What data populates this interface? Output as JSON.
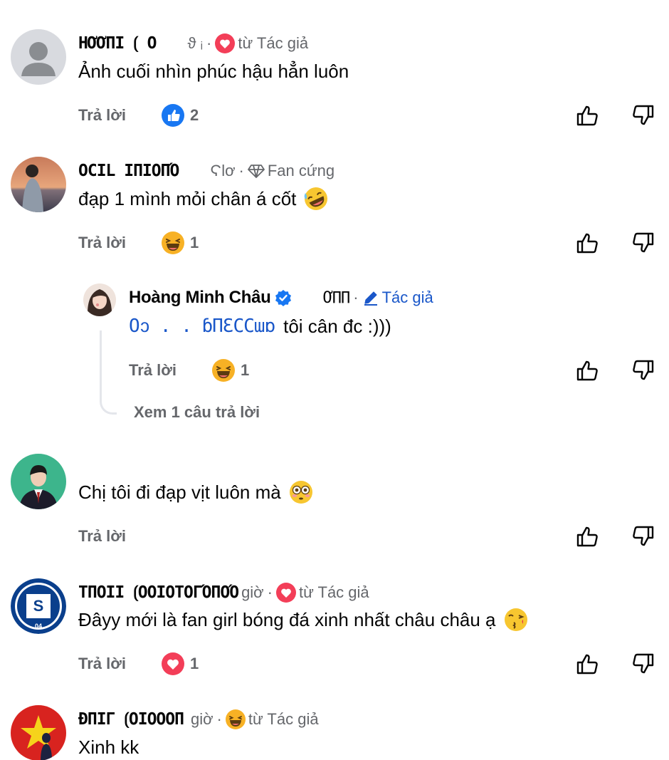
{
  "comments": [
    {
      "name": "HƠƠΠI    ⟮ O",
      "time": "ϑ ᵢ",
      "badge": "từ Tác giả",
      "badge_icon": "heart-reaction-icon",
      "text": "Ảnh cuối nhìn phúc hậu hẳn luôn",
      "reply_label": "Trả lời",
      "reaction_icon": "like-reaction-icon",
      "reaction_count": "2"
    },
    {
      "name": "OCIL ΙΠΙΟΠΌ",
      "time": "Ϛlơ",
      "badge": "Fan cứng",
      "badge_icon": "diamond-icon",
      "text": "đạp 1 mình mỏi chân á cốt",
      "emoji": "rofl-emoji",
      "reply_label": "Trả lời",
      "reaction_icon": "haha-reaction-icon",
      "reaction_count": "1"
    },
    {
      "name": "",
      "time": "",
      "text": "Chị tôi đi đạp vịt luôn mà",
      "emoji": "flushed-emoji",
      "reply_label": "Trả lời"
    },
    {
      "name": "TΠΟΙΙ ⟮ΟΟΙΟΤΟΓΌΠΟΌ",
      "time": "giờ",
      "badge": "từ Tác giả",
      "badge_icon": "heart-reaction-icon",
      "text": "Đâyy mới là fan girl bóng đá xinh nhất châu châu ạ",
      "emoji": "kissing-emoji",
      "reply_label": "Trả lời",
      "reaction_icon": "love-reaction-icon",
      "reaction_count": "1"
    },
    {
      "name": "ĐΠΙΓ ⟮ΟΙΟΟΟΠ",
      "time": "giờ",
      "badge": "từ Tác giả",
      "badge_icon": "haha-reaction-icon",
      "text": "Xinh kk"
    }
  ],
  "reply": {
    "name": "Hoàng Minh Châu",
    "time": "ƠΠΠ",
    "badge": "Tác giả",
    "badge_icon": "pencil-icon",
    "mention": "Oↄ . . ɓΠƐϹϹɯɒ",
    "text": "tôi cân đc :)))",
    "reply_label": "Trả lời",
    "reaction_icon": "haha-reaction-icon",
    "reaction_count": "1",
    "see_more": "Xem 1 câu trả lời"
  },
  "colors": {
    "secondary_text": "#65676b",
    "like_blue": "#1877f2",
    "love_red": "#f33e58",
    "haha_yellow": "#f7b125"
  }
}
